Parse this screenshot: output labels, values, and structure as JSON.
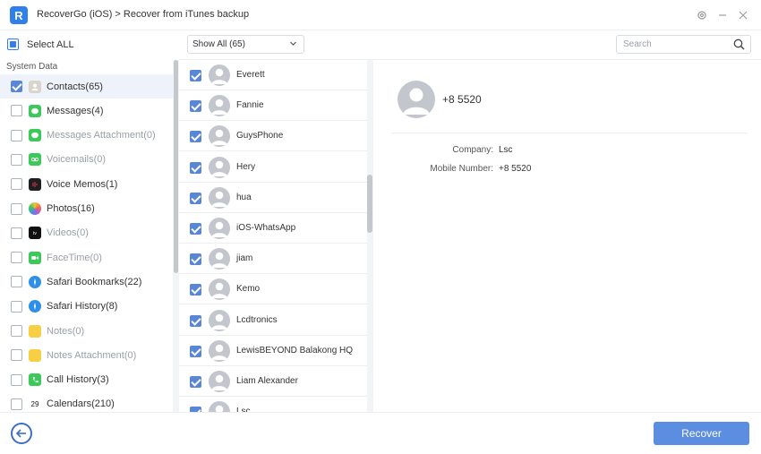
{
  "window": {
    "logo_letter": "R",
    "title": "RecoverGo (iOS) > Recover from iTunes backup",
    "accent_color": "#2f80ed"
  },
  "toolbar": {
    "select_all_label": "Select ALL",
    "filter_selected": "Show All (65)",
    "search_placeholder": "Search"
  },
  "sidebar": {
    "section_title": "System Data",
    "items": [
      {
        "label": "Contacts(65)",
        "icon": "contacts-icon",
        "checked": true,
        "active": true,
        "dim": false,
        "color": "#d9d4cc"
      },
      {
        "label": "Messages(4)",
        "icon": "messages-icon",
        "checked": false,
        "active": false,
        "dim": false,
        "color": "#3cc95a"
      },
      {
        "label": "Messages Attachment(0)",
        "icon": "messages-attachment-icon",
        "checked": false,
        "active": false,
        "dim": true,
        "color": "#3cc95a"
      },
      {
        "label": "Voicemails(0)",
        "icon": "voicemail-icon",
        "checked": false,
        "active": false,
        "dim": true,
        "color": "#3cc95a"
      },
      {
        "label": "Voice Memos(1)",
        "icon": "voice-memos-icon",
        "checked": false,
        "active": false,
        "dim": false,
        "color": "#1f1f1f"
      },
      {
        "label": "Photos(16)",
        "icon": "photos-icon",
        "checked": false,
        "active": false,
        "dim": false,
        "color": "#f2a33a"
      },
      {
        "label": "Videos(0)",
        "icon": "apple-tv-icon",
        "checked": false,
        "active": false,
        "dim": true,
        "color": "#111111"
      },
      {
        "label": "FaceTime(0)",
        "icon": "facetime-icon",
        "checked": false,
        "active": false,
        "dim": true,
        "color": "#3cc95a"
      },
      {
        "label": "Safari Bookmarks(22)",
        "icon": "safari-icon",
        "checked": false,
        "active": false,
        "dim": false,
        "color": "#2f8fe6"
      },
      {
        "label": "Safari History(8)",
        "icon": "safari-icon",
        "checked": false,
        "active": false,
        "dim": false,
        "color": "#2f8fe6"
      },
      {
        "label": "Notes(0)",
        "icon": "notes-icon",
        "checked": false,
        "active": false,
        "dim": true,
        "color": "#f6cf45"
      },
      {
        "label": "Notes Attachment(0)",
        "icon": "notes-attachment-icon",
        "checked": false,
        "active": false,
        "dim": true,
        "color": "#f6cf45"
      },
      {
        "label": "Call History(3)",
        "icon": "phone-icon",
        "checked": false,
        "active": false,
        "dim": false,
        "color": "#3cc95a"
      },
      {
        "label": "Calendars(210)",
        "icon": "calendar-icon",
        "checked": false,
        "active": false,
        "dim": false,
        "color": "#ffffff",
        "icon_text": "29"
      }
    ]
  },
  "contacts": [
    {
      "name": "Everett",
      "checked": true
    },
    {
      "name": "Fannie",
      "checked": true
    },
    {
      "name": "GuysPhone",
      "checked": true
    },
    {
      "name": "Hery",
      "checked": true
    },
    {
      "name": "hua",
      "checked": true
    },
    {
      "name": "iOS-WhatsApp",
      "checked": true
    },
    {
      "name": "jiam",
      "checked": true
    },
    {
      "name": "Kemo",
      "checked": true
    },
    {
      "name": "Lcdtronics",
      "checked": true
    },
    {
      "name": "LewisBEYOND Balakong HQ",
      "checked": true
    },
    {
      "name": "Liam Alexander",
      "checked": true
    },
    {
      "name": "Lsc",
      "checked": true
    }
  ],
  "detail": {
    "name": "+8 5520",
    "fields": [
      {
        "label": "Company:",
        "value": "Lsc"
      },
      {
        "label": "Mobile Number:",
        "value": "+8 5520"
      }
    ]
  },
  "footer": {
    "recover_label": "Recover",
    "recover_color": "#5b8de0"
  }
}
